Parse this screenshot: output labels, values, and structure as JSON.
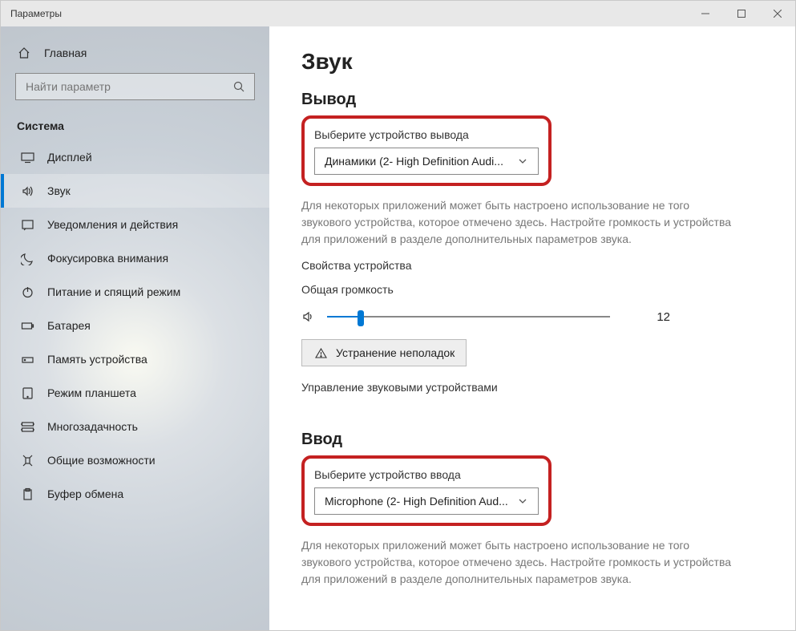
{
  "window": {
    "title": "Параметры"
  },
  "sidebar": {
    "home": "Главная",
    "search_placeholder": "Найти параметр",
    "section": "Система",
    "items": [
      {
        "icon": "display",
        "label": "Дисплей"
      },
      {
        "icon": "sound",
        "label": "Звук",
        "active": true
      },
      {
        "icon": "notifications",
        "label": "Уведомления и действия"
      },
      {
        "icon": "focus",
        "label": "Фокусировка внимания"
      },
      {
        "icon": "power",
        "label": "Питание и спящий режим"
      },
      {
        "icon": "battery",
        "label": "Батарея"
      },
      {
        "icon": "storage",
        "label": "Память устройства"
      },
      {
        "icon": "tablet",
        "label": "Режим планшета"
      },
      {
        "icon": "multitask",
        "label": "Многозадачность"
      },
      {
        "icon": "accessibility",
        "label": "Общие возможности"
      },
      {
        "icon": "clipboard",
        "label": "Буфер обмена"
      }
    ]
  },
  "main": {
    "title": "Звук",
    "output": {
      "heading": "Вывод",
      "choose_label": "Выберите устройство вывода",
      "device": "Динамики (2- High Definition Audi...",
      "note": "Для некоторых приложений может быть настроено использование не того звукового устройства, которое отмечено здесь. Настройте громкость и устройства для приложений в разделе дополнительных параметров звука.",
      "properties": "Свойства устройства",
      "volume_label": "Общая громкость",
      "volume_value": 12,
      "troubleshoot": "Устранение неполадок",
      "manage": "Управление звуковыми устройствами"
    },
    "input": {
      "heading": "Ввод",
      "choose_label": "Выберите устройство ввода",
      "device": "Microphone (2- High Definition Aud...",
      "note": "Для некоторых приложений может быть настроено использование не того звукового устройства, которое отмечено здесь. Настройте громкость и устройства для приложений в разделе дополнительных параметров звука."
    }
  }
}
